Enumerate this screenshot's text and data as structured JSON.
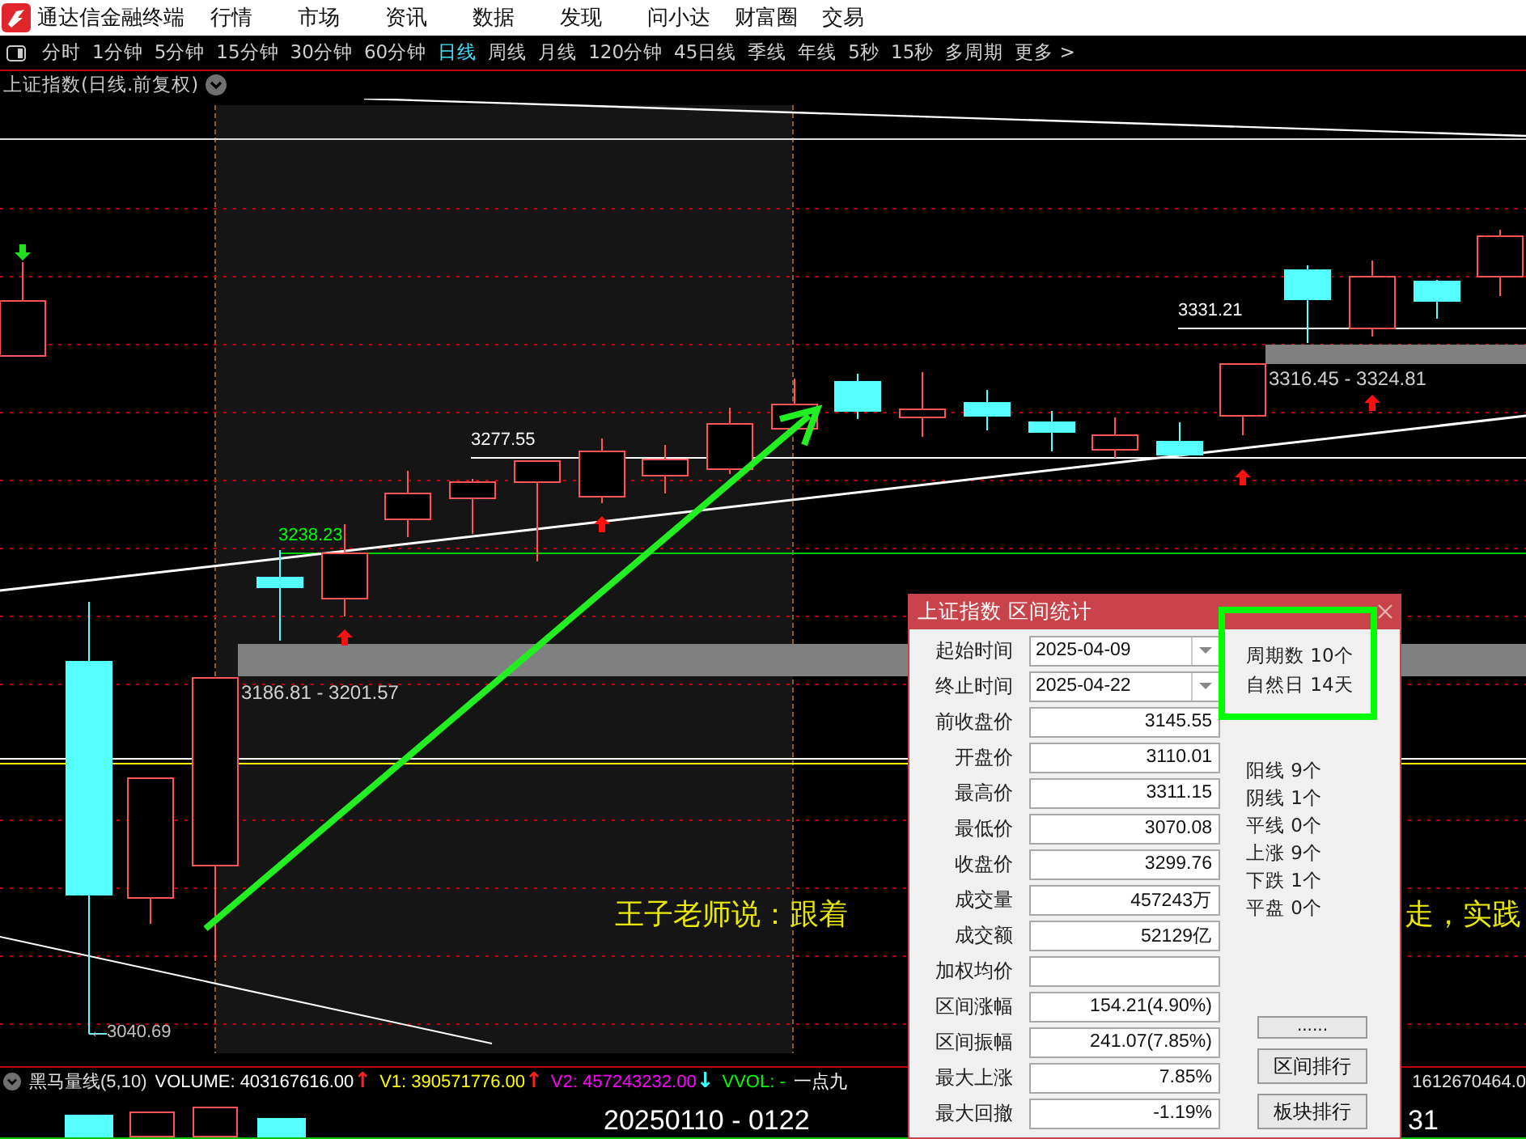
{
  "menu_bar": {
    "app_title": "通达信金融终端",
    "items": [
      "行情",
      "市场",
      "资讯",
      "数据",
      "发现",
      "问小达",
      "财富圈",
      "交易"
    ]
  },
  "period_bar": {
    "items": [
      {
        "label": "分时",
        "selected": false
      },
      {
        "label": "1分钟",
        "selected": false
      },
      {
        "label": "5分钟",
        "selected": false
      },
      {
        "label": "15分钟",
        "selected": false
      },
      {
        "label": "30分钟",
        "selected": false
      },
      {
        "label": "60分钟",
        "selected": false
      },
      {
        "label": "日线",
        "selected": true
      },
      {
        "label": "周线",
        "selected": false
      },
      {
        "label": "月线",
        "selected": false
      },
      {
        "label": "120分钟",
        "selected": false
      },
      {
        "label": "45日线",
        "selected": false
      },
      {
        "label": "季线",
        "selected": false
      },
      {
        "label": "年线",
        "selected": false
      },
      {
        "label": "5秒",
        "selected": false
      },
      {
        "label": "15秒",
        "selected": false
      },
      {
        "label": "多周期",
        "selected": false
      },
      {
        "label": "更多 >",
        "selected": false
      }
    ]
  },
  "chart": {
    "title": "上证指数(日线.前复权)",
    "price_labels": [
      {
        "text": "3238.23",
        "color": "#00ff00"
      },
      {
        "text": "3277.55",
        "color": "#ffffff"
      },
      {
        "text": "3331.21",
        "color": "#ffffff"
      }
    ],
    "zone_labels": [
      "3186.81 - 3201.57",
      "3316.45 - 3324.81"
    ],
    "low_label": "←3040.69",
    "banner_left": "王子老师说：跟着",
    "banner_right": "走，实践"
  },
  "range_dialog": {
    "title": "上证指数 区间统计",
    "dates": [
      {
        "label": "起始时间",
        "value": "2025-04-09"
      },
      {
        "label": "终止时间",
        "value": "2025-04-22"
      }
    ],
    "fields": [
      {
        "label": "前收盘价",
        "value": "3145.55"
      },
      {
        "label": "开盘价",
        "value": "3110.01"
      },
      {
        "label": "最高价",
        "value": "3311.15"
      },
      {
        "label": "最低价",
        "value": "3070.08"
      },
      {
        "label": "收盘价",
        "value": "3299.76"
      },
      {
        "label": "成交量",
        "value": "457243万"
      },
      {
        "label": "成交额",
        "value": "52129亿"
      },
      {
        "label": "加权均价"
      },
      {
        "label": "区间涨幅",
        "value": "154.21(4.90%)"
      },
      {
        "label": "区间振幅",
        "value": "241.07(7.85%)"
      },
      {
        "label": "最大上涨",
        "value": "7.85%"
      },
      {
        "label": "最大回撤",
        "value": "-1.19%"
      }
    ],
    "summary": [
      "周期数 10个",
      "自然日 14天"
    ],
    "stats": [
      "阳线 9个",
      "阴线 1个",
      "平线 0个",
      "上涨 9个",
      "下跌 1个",
      "平盘 0个"
    ],
    "buttons": [
      "......",
      "区间排行",
      "板块排行"
    ]
  },
  "indicator_bar": {
    "name": "黑马量线(5,10)",
    "readouts": [
      {
        "text": "VOLUME: 403167616.00",
        "color": "#ffffff"
      },
      {
        "text": "↑",
        "color": "#ff2020",
        "kind": "arrow"
      },
      {
        "text": "V1: 390571776.00",
        "color": "#ffff00"
      },
      {
        "text": "↑",
        "color": "#ff2020",
        "kind": "arrow"
      },
      {
        "text": "V2: 457243232.00",
        "color": "#ff00ff"
      },
      {
        "text": "↓",
        "color": "#40ffff",
        "kind": "arrow"
      },
      {
        "text": "VVOL: -",
        "color": "#00ff00"
      },
      {
        "text": "一点九",
        "color": "#ffffff"
      }
    ],
    "right_value": "1612670464.0",
    "date_range": "20250110 - 0122",
    "right_date": "31"
  }
}
